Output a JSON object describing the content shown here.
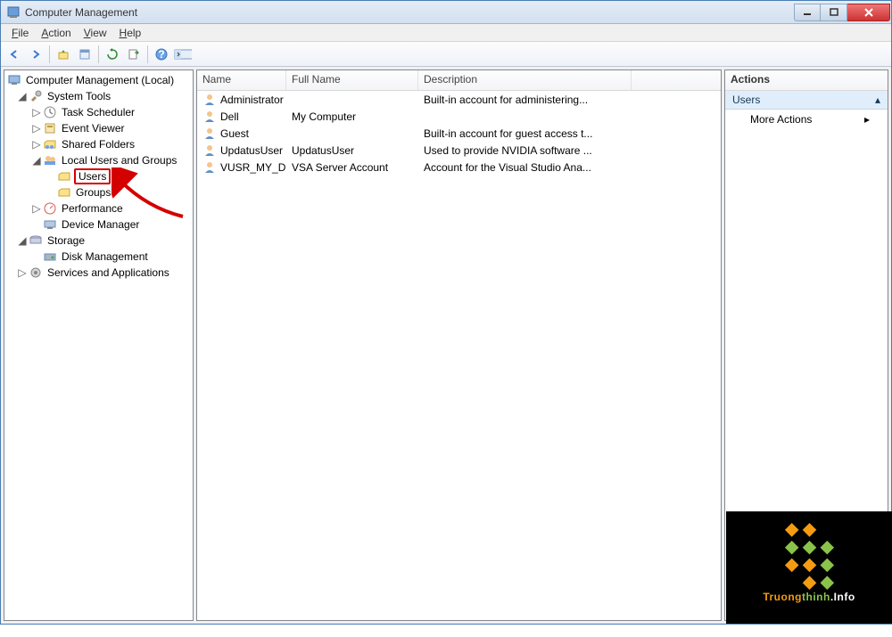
{
  "window": {
    "title": "Computer Management"
  },
  "menu": {
    "file": "File",
    "action": "Action",
    "view": "View",
    "help": "Help"
  },
  "tree": {
    "root": "Computer Management (Local)",
    "system_tools": "System Tools",
    "task_scheduler": "Task Scheduler",
    "event_viewer": "Event Viewer",
    "shared_folders": "Shared Folders",
    "local_users": "Local Users and Groups",
    "users": "Users",
    "groups": "Groups",
    "performance": "Performance",
    "device_manager": "Device Manager",
    "storage": "Storage",
    "disk_management": "Disk Management",
    "services_apps": "Services and Applications"
  },
  "columns": {
    "name": "Name",
    "fullname": "Full Name",
    "description": "Description"
  },
  "rows": [
    {
      "name": "Administrator",
      "fullname": "",
      "description": "Built-in account for administering..."
    },
    {
      "name": "Dell",
      "fullname": "My Computer",
      "description": ""
    },
    {
      "name": "Guest",
      "fullname": "",
      "description": "Built-in account for guest access t..."
    },
    {
      "name": "UpdatusUser",
      "fullname": "UpdatusUser",
      "description": "Used to provide NVIDIA software ..."
    },
    {
      "name": "VUSR_MY_D...",
      "fullname": "VSA Server Account",
      "description": "Account for the Visual Studio Ana..."
    }
  ],
  "actions": {
    "header": "Actions",
    "sub": "Users",
    "more": "More Actions"
  },
  "watermark": {
    "brand1": "Truong",
    "brand2": "thinh",
    "brand3": ".Info"
  }
}
